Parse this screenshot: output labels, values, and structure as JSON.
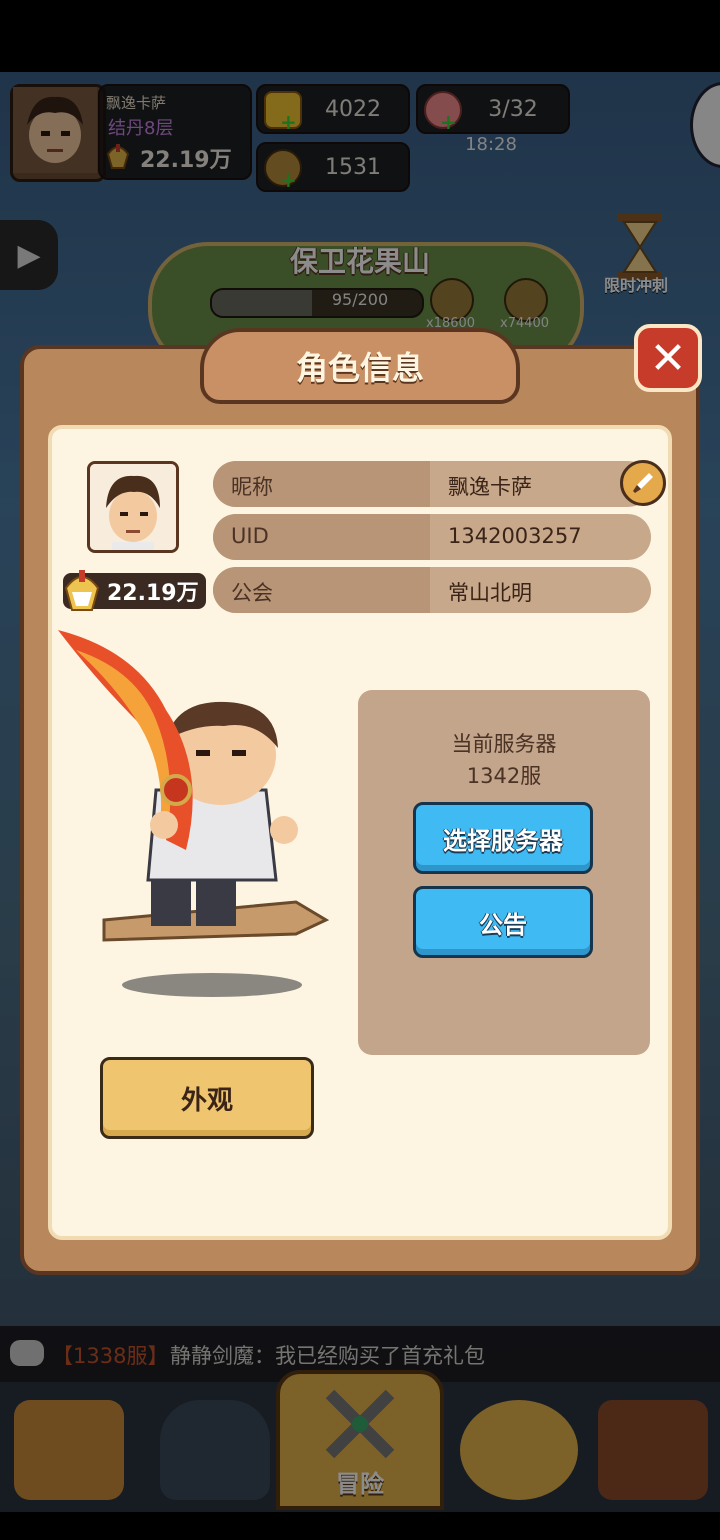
{
  "hud": {
    "player_name": "飘逸卡萨",
    "realm": "结丹8层",
    "power": "22.19万",
    "gold": "4022",
    "coins": "1531",
    "stamina": "3/32",
    "timer": "18:28"
  },
  "event": {
    "title": "保卫花果山",
    "progress_text": "95/200",
    "progress": 0.475,
    "reward1": "x18600",
    "reward2": "x74400",
    "limited_label": "限时冲刺"
  },
  "dialog": {
    "title": "角色信息",
    "close_icon": "close-icon",
    "power": "22.19万",
    "fields": [
      {
        "key": "昵称",
        "value": "飘逸卡萨"
      },
      {
        "key": "UID",
        "value": "1342003257"
      },
      {
        "key": "公会",
        "value": "常山北明"
      }
    ],
    "server_label": "当前服务器",
    "server_value": "1342服",
    "select_server_button": "选择服务器",
    "notice_button": "公告",
    "appearance_button": "外观"
  },
  "chat": {
    "server": "【1338服】",
    "message": "静静剑魔：我已经购买了首充礼包"
  },
  "nav": {
    "adventure_label": "冒险"
  },
  "colors": {
    "dialog_bg": "#b8875c",
    "panel_bg": "#fdf5e2",
    "blue_button": "#3fbaf2",
    "gold_button": "#efc66f",
    "close_button": "#c63b2a"
  }
}
